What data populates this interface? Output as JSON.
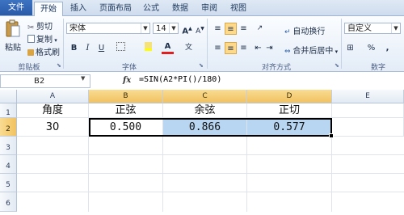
{
  "ribbon_tabs": [
    "文件",
    "开始",
    "插入",
    "页面布局",
    "公式",
    "数据",
    "审阅",
    "视图"
  ],
  "clipboard": {
    "paste": "粘贴",
    "cut": "剪切",
    "copy": "复制",
    "format_painter": "格式刷",
    "label": "剪贴板"
  },
  "font": {
    "name": "宋体",
    "size": "14",
    "label": "字体",
    "bold": "B",
    "italic": "I",
    "underline": "U"
  },
  "alignment": {
    "wrap_text": "自动换行",
    "merge_center": "合并后居中",
    "label": "对齐方式"
  },
  "number": {
    "format": "自定义",
    "label": "数字",
    "percent": "%",
    "comma": ","
  },
  "formula_bar": {
    "name_box": "B2",
    "fx": "fx",
    "formula": "=SIN(A2*PI()/180)"
  },
  "columns": [
    "A",
    "B",
    "C",
    "D",
    "E"
  ],
  "rows": [
    "1",
    "2",
    "3",
    "4",
    "5",
    "6"
  ],
  "cells": {
    "header": [
      "角度",
      "正弦",
      "余弦",
      "正切"
    ],
    "values": [
      "30",
      "0.500",
      "0.866",
      "0.577"
    ]
  },
  "colors": {
    "selection_fill": "#b8d5f1",
    "selected_header": "#f1c260",
    "file_tab": "#2a5aa8"
  }
}
